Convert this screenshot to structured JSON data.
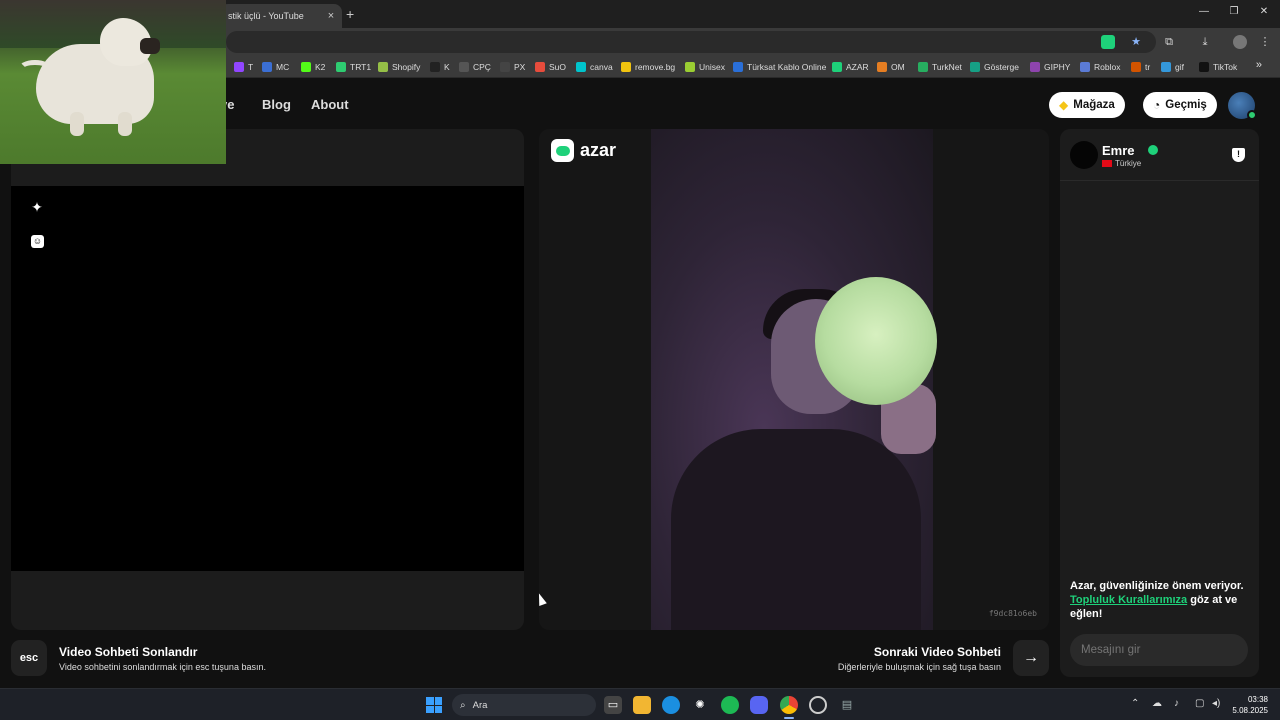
{
  "browser": {
    "tab_title": "stik üçlü - YouTube",
    "tab_close": "×",
    "new_tab": "+",
    "window_controls": [
      "—",
      "❐",
      "✕"
    ],
    "bookmarks": [
      {
        "label": "T",
        "color": "#9146ff"
      },
      {
        "label": "MC",
        "color": "#3b6fd4"
      },
      {
        "label": "K2",
        "color": "#53fc18"
      },
      {
        "label": "TRT1",
        "color": "#2ecc71"
      },
      {
        "label": "Shopify",
        "color": "#95bf47"
      },
      {
        "label": "K",
        "color": "#222222"
      },
      {
        "label": "CPÇ",
        "color": "#555555"
      },
      {
        "label": "PX",
        "color": "#444444"
      },
      {
        "label": "SuO",
        "color": "#e74c3c"
      },
      {
        "label": "canva",
        "color": "#00c4cc"
      },
      {
        "label": "remove.bg",
        "color": "#f1c40f"
      },
      {
        "label": "Unisex",
        "color": "#9acd32"
      },
      {
        "label": "Türksat Kablo Online",
        "color": "#2a6fd8"
      },
      {
        "label": "AZAR",
        "color": "#1ed17a"
      },
      {
        "label": "OM",
        "color": "#e67e22"
      },
      {
        "label": "TurkNet",
        "color": "#27ae60"
      },
      {
        "label": "Gösterge",
        "color": "#16a085"
      },
      {
        "label": "GIPHY",
        "color": "#8e44ad"
      },
      {
        "label": "Roblox",
        "color": "#5b7bd5"
      },
      {
        "label": "tr",
        "color": "#d35400"
      },
      {
        "label": "gif",
        "color": "#3498db"
      },
      {
        "label": "TikTok",
        "color": "#111111"
      }
    ],
    "bookmarks_more": "»"
  },
  "nav": {
    "links": [
      "ve",
      "Blog",
      "About"
    ],
    "store_button": "Mağaza",
    "history_button": "Geçmiş"
  },
  "video": {
    "brand": "azar",
    "remote_id": "f9dc81o6eb"
  },
  "chat": {
    "user_name": "Emre",
    "country": "Türkiye",
    "safety_text_start": "Azar, güvenliğinize önem veriyor.",
    "safety_link": "Topluluk Kurallarımıza",
    "safety_text_end": "göz at ve eğlen!",
    "message_placeholder": "Mesajını gir"
  },
  "controls": {
    "end_key": "esc",
    "end_title": "Video Sohbeti Sonlandır",
    "end_sub": "Video sohbetini sonlandırmak için esc tuşuna basın.",
    "next_title": "Sonraki Video Sohbeti",
    "next_sub": "Diğerleriyle buluşmak için sağ tuşa basın",
    "next_arrow": "→"
  },
  "taskbar": {
    "search_label": "Ara",
    "time": "03:38",
    "date": "5.08.2025"
  }
}
